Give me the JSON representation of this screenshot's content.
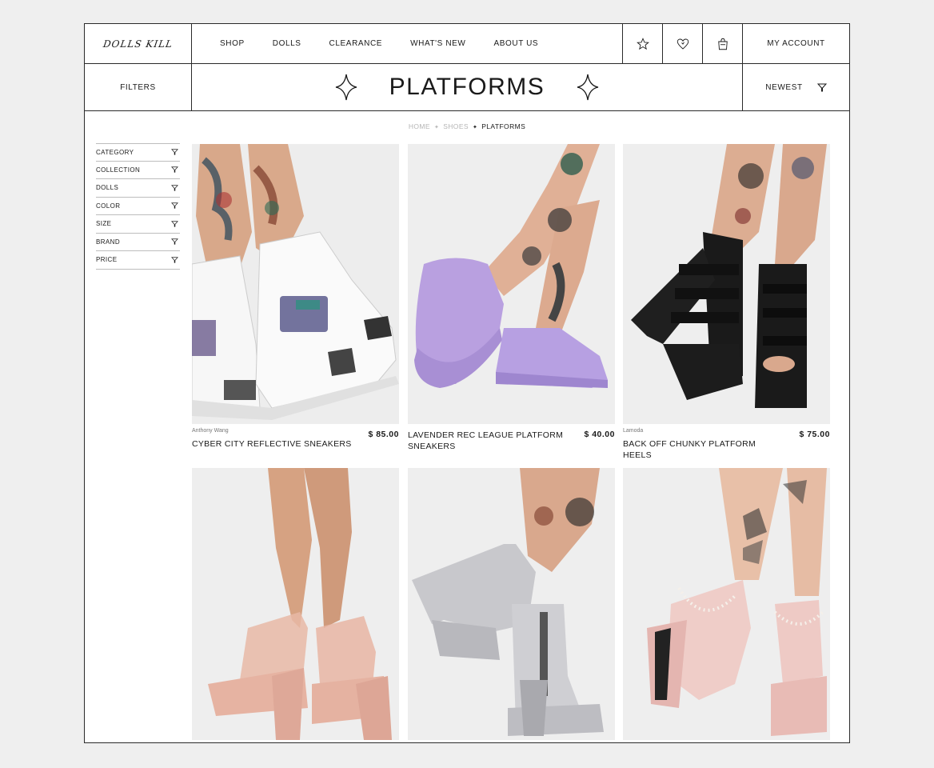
{
  "brand_logo": "DOLLS KILL",
  "nav": {
    "items": [
      "SHOP",
      "DOLLS",
      "CLEARANCE",
      "WHAT'S NEW",
      "ABOUT US"
    ],
    "icons": [
      "star-icon",
      "heart-icon",
      "bag-icon"
    ],
    "account_label": "MY ACCOUNT"
  },
  "titlebar": {
    "filters_label": "FILTERS",
    "title": "PLATFORMS",
    "sort_label": "NEWEST"
  },
  "breadcrumb": [
    "HOME",
    "SHOES",
    "PLATFORMS"
  ],
  "filters": [
    "CATEGORY",
    "COLLECTION",
    "DOLLS",
    "COLOR",
    "SIZE",
    "BRAND",
    "PRICE"
  ],
  "products": [
    {
      "brand": "Anthony Wang",
      "name": "CYBER CITY REFLECTIVE SNEAKERS",
      "price": "$ 85.00"
    },
    {
      "brand": "",
      "name": "LAVENDER REC LEAGUE PLATFORM SNEAKERS",
      "price": "$ 40.00"
    },
    {
      "brand": "Lamoda",
      "name": "BACK OFF CHUNKY PLATFORM HEELS",
      "price": "$ 75.00"
    },
    {
      "brand": "",
      "name": "",
      "price": ""
    },
    {
      "brand": "",
      "name": "",
      "price": ""
    },
    {
      "brand": "",
      "name": "",
      "price": ""
    }
  ],
  "colors": {
    "border": "#2a2a2a",
    "muted": "#b5b5b5"
  }
}
